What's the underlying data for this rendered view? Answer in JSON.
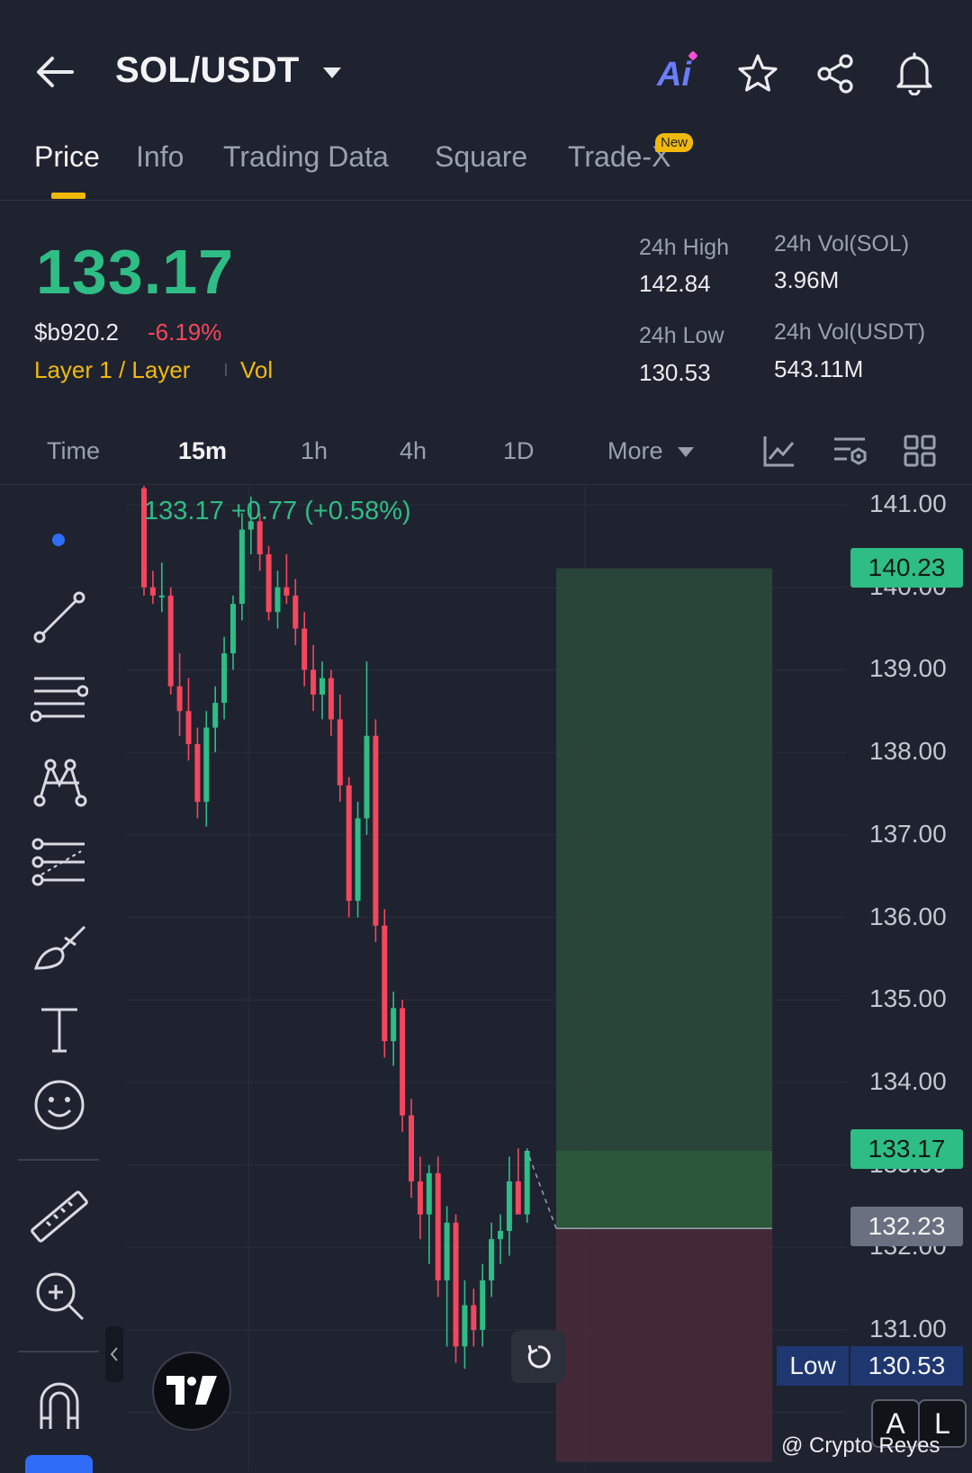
{
  "header": {
    "pair": "SOL/USDT",
    "ai_label": "Ai"
  },
  "tabs": [
    {
      "label": "Price",
      "active": true
    },
    {
      "label": "Info"
    },
    {
      "label": "Trading Data"
    },
    {
      "label": "Square"
    },
    {
      "label": "Trade-X",
      "badge": "New"
    }
  ],
  "price": {
    "last": "133.17",
    "fiat": "$b920.2",
    "change": "-6.19%",
    "tag_layer": "Layer 1 / Layer",
    "tag_vol": "Vol"
  },
  "stats": {
    "high_label": "24h High",
    "high_value": "142.84",
    "low_label": "24h Low",
    "low_value": "130.53",
    "vol_base_label": "24h Vol(SOL)",
    "vol_base_value": "3.96M",
    "vol_quote_label": "24h Vol(USDT)",
    "vol_quote_value": "543.11M"
  },
  "timeframes": {
    "items": [
      "Time",
      "15m",
      "1h",
      "4h",
      "1D",
      "More"
    ],
    "active": "15m"
  },
  "chart": {
    "ohlc_readout": "133.17  +0.77 (+0.58%)",
    "y_ticks": [
      "141.00",
      "140.00",
      "139.00",
      "138.00",
      "137.00",
      "136.00",
      "135.00",
      "134.00",
      "133.00",
      "132.00",
      "131.00"
    ],
    "target_price": "140.23",
    "current_price": "133.17",
    "entry_price": "132.23",
    "low_label": "Low",
    "low_value": "130.53",
    "btn_a": "A",
    "btn_l": "L",
    "watermark": "@ Crypto Reyes",
    "colors": {
      "up": "#2ebd85",
      "down": "#f6465d",
      "accent": "#f0b90b"
    }
  },
  "chart_data": {
    "type": "candlestick",
    "interval": "15m",
    "ylim": [
      130.0,
      141.3
    ],
    "candles": [
      [
        141.2,
        141.4,
        139.9,
        140.0
      ],
      [
        140.0,
        140.2,
        139.8,
        139.9
      ],
      [
        139.9,
        140.3,
        139.7,
        139.9
      ],
      [
        139.9,
        140.0,
        138.7,
        138.8
      ],
      [
        138.8,
        139.2,
        138.2,
        138.5
      ],
      [
        138.5,
        138.9,
        137.9,
        138.1
      ],
      [
        138.1,
        138.3,
        137.2,
        137.4
      ],
      [
        137.4,
        138.5,
        137.1,
        138.3
      ],
      [
        138.3,
        138.8,
        138.0,
        138.6
      ],
      [
        138.6,
        139.4,
        138.4,
        139.2
      ],
      [
        139.2,
        139.9,
        139.0,
        139.8
      ],
      [
        139.8,
        140.9,
        139.6,
        140.7
      ],
      [
        140.7,
        141.1,
        140.4,
        140.8
      ],
      [
        140.8,
        140.9,
        140.2,
        140.4
      ],
      [
        140.4,
        140.5,
        139.6,
        139.7
      ],
      [
        139.7,
        140.2,
        139.5,
        140.0
      ],
      [
        140.0,
        140.4,
        139.8,
        139.9
      ],
      [
        139.9,
        140.1,
        139.3,
        139.5
      ],
      [
        139.5,
        139.7,
        138.8,
        139.0
      ],
      [
        139.0,
        139.3,
        138.5,
        138.7
      ],
      [
        138.7,
        139.1,
        138.4,
        138.9
      ],
      [
        138.9,
        139.0,
        138.2,
        138.4
      ],
      [
        138.4,
        138.7,
        137.4,
        137.6
      ],
      [
        137.6,
        137.7,
        136.0,
        136.2
      ],
      [
        136.2,
        137.4,
        136.0,
        137.2
      ],
      [
        137.2,
        139.1,
        137.0,
        138.2
      ],
      [
        138.2,
        138.4,
        135.7,
        135.9
      ],
      [
        135.9,
        136.1,
        134.3,
        134.5
      ],
      [
        134.5,
        135.1,
        134.2,
        134.9
      ],
      [
        134.9,
        135.0,
        133.4,
        133.6
      ],
      [
        133.6,
        133.8,
        132.6,
        132.8
      ],
      [
        132.8,
        133.1,
        132.1,
        132.4
      ],
      [
        132.4,
        133.0,
        131.8,
        132.9
      ],
      [
        132.9,
        133.1,
        131.4,
        131.6
      ],
      [
        131.6,
        132.5,
        130.8,
        132.3
      ],
      [
        132.3,
        132.4,
        130.6,
        130.8
      ],
      [
        130.8,
        131.6,
        130.53,
        131.3
      ],
      [
        131.3,
        131.5,
        130.8,
        131.0
      ],
      [
        131.0,
        131.8,
        130.8,
        131.6
      ],
      [
        131.6,
        132.3,
        131.4,
        132.1
      ],
      [
        132.1,
        132.4,
        131.8,
        132.2
      ],
      [
        132.2,
        133.1,
        131.9,
        132.8
      ],
      [
        132.8,
        133.2,
        132.6,
        132.4
      ],
      [
        132.4,
        133.2,
        132.3,
        133.17
      ]
    ],
    "position": {
      "target": 140.23,
      "entry": 132.23,
      "stop": 129.4
    }
  }
}
